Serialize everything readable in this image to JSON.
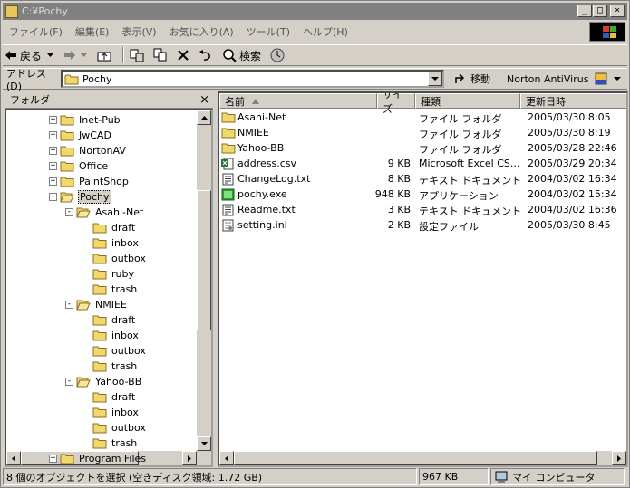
{
  "window": {
    "title": "C:¥Pochy"
  },
  "menu": [
    "ファイル(F)",
    "編集(E)",
    "表示(V)",
    "お気に入り(A)",
    "ツール(T)",
    "ヘルプ(H)"
  ],
  "toolbar": {
    "back_label": "戻る",
    "search_label": "検索"
  },
  "address": {
    "label": "アドレス(D)",
    "value": "Pochy",
    "go_label": "移動",
    "norton_label": "Norton AntiVirus"
  },
  "folders_pane": {
    "title": "フォルダ"
  },
  "tree": [
    {
      "label": "Inet-Pub",
      "level": 0,
      "expander": "+"
    },
    {
      "label": "JwCAD",
      "level": 0,
      "expander": "+"
    },
    {
      "label": "NortonAV",
      "level": 0,
      "expander": "+"
    },
    {
      "label": "Office",
      "level": 0,
      "expander": "+"
    },
    {
      "label": "PaintShop",
      "level": 0,
      "expander": "+"
    },
    {
      "label": "Pochy",
      "level": 0,
      "expander": "-",
      "open": true,
      "selected": true
    },
    {
      "label": "Asahi-Net",
      "level": 1,
      "expander": "-",
      "open": true
    },
    {
      "label": "draft",
      "level": 2
    },
    {
      "label": "inbox",
      "level": 2
    },
    {
      "label": "outbox",
      "level": 2
    },
    {
      "label": "ruby",
      "level": 2
    },
    {
      "label": "trash",
      "level": 2
    },
    {
      "label": "NMIEE",
      "level": 1,
      "expander": "-",
      "open": true
    },
    {
      "label": "draft",
      "level": 2
    },
    {
      "label": "inbox",
      "level": 2
    },
    {
      "label": "outbox",
      "level": 2
    },
    {
      "label": "trash",
      "level": 2
    },
    {
      "label": "Yahoo-BB",
      "level": 1,
      "expander": "-",
      "open": true
    },
    {
      "label": "draft",
      "level": 2
    },
    {
      "label": "inbox",
      "level": 2
    },
    {
      "label": "outbox",
      "level": 2
    },
    {
      "label": "trash",
      "level": 2
    },
    {
      "label": "Program Files",
      "level": 0,
      "expander": "+"
    }
  ],
  "columns": {
    "name": "名前",
    "size": "サイズ",
    "type": "種類",
    "modified": "更新日時"
  },
  "files": [
    {
      "name": "Asahi-Net",
      "size": "",
      "type": "ファイル フォルダ",
      "modified": "2005/03/30 8:05",
      "icon": "folder"
    },
    {
      "name": "NMIEE",
      "size": "",
      "type": "ファイル フォルダ",
      "modified": "2005/03/30 8:19",
      "icon": "folder"
    },
    {
      "name": "Yahoo-BB",
      "size": "",
      "type": "ファイル フォルダ",
      "modified": "2005/03/28 22:46",
      "icon": "folder"
    },
    {
      "name": "address.csv",
      "size": "9 KB",
      "type": "Microsoft Excel CS...",
      "modified": "2005/03/29 20:34",
      "icon": "excel"
    },
    {
      "name": "ChangeLog.txt",
      "size": "8 KB",
      "type": "テキスト ドキュメント",
      "modified": "2004/03/02 16:34",
      "icon": "text"
    },
    {
      "name": "pochy.exe",
      "size": "948 KB",
      "type": "アプリケーション",
      "modified": "2004/03/02 15:34",
      "icon": "exe"
    },
    {
      "name": "Readme.txt",
      "size": "3 KB",
      "type": "テキスト ドキュメント",
      "modified": "2004/03/02 16:36",
      "icon": "text"
    },
    {
      "name": "setting.ini",
      "size": "2 KB",
      "type": "設定ファイル",
      "modified": "2005/03/30 8:45",
      "icon": "ini"
    }
  ],
  "status": {
    "selection": "8 個のオブジェクトを選択 (空きディスク領域: 1.72 GB)",
    "size": "967 KB",
    "location": "マイ コンピュータ"
  },
  "colors": {
    "folder": "#f2d86a",
    "titlebar_inactive": "#808080",
    "face": "#d4d0c8"
  }
}
